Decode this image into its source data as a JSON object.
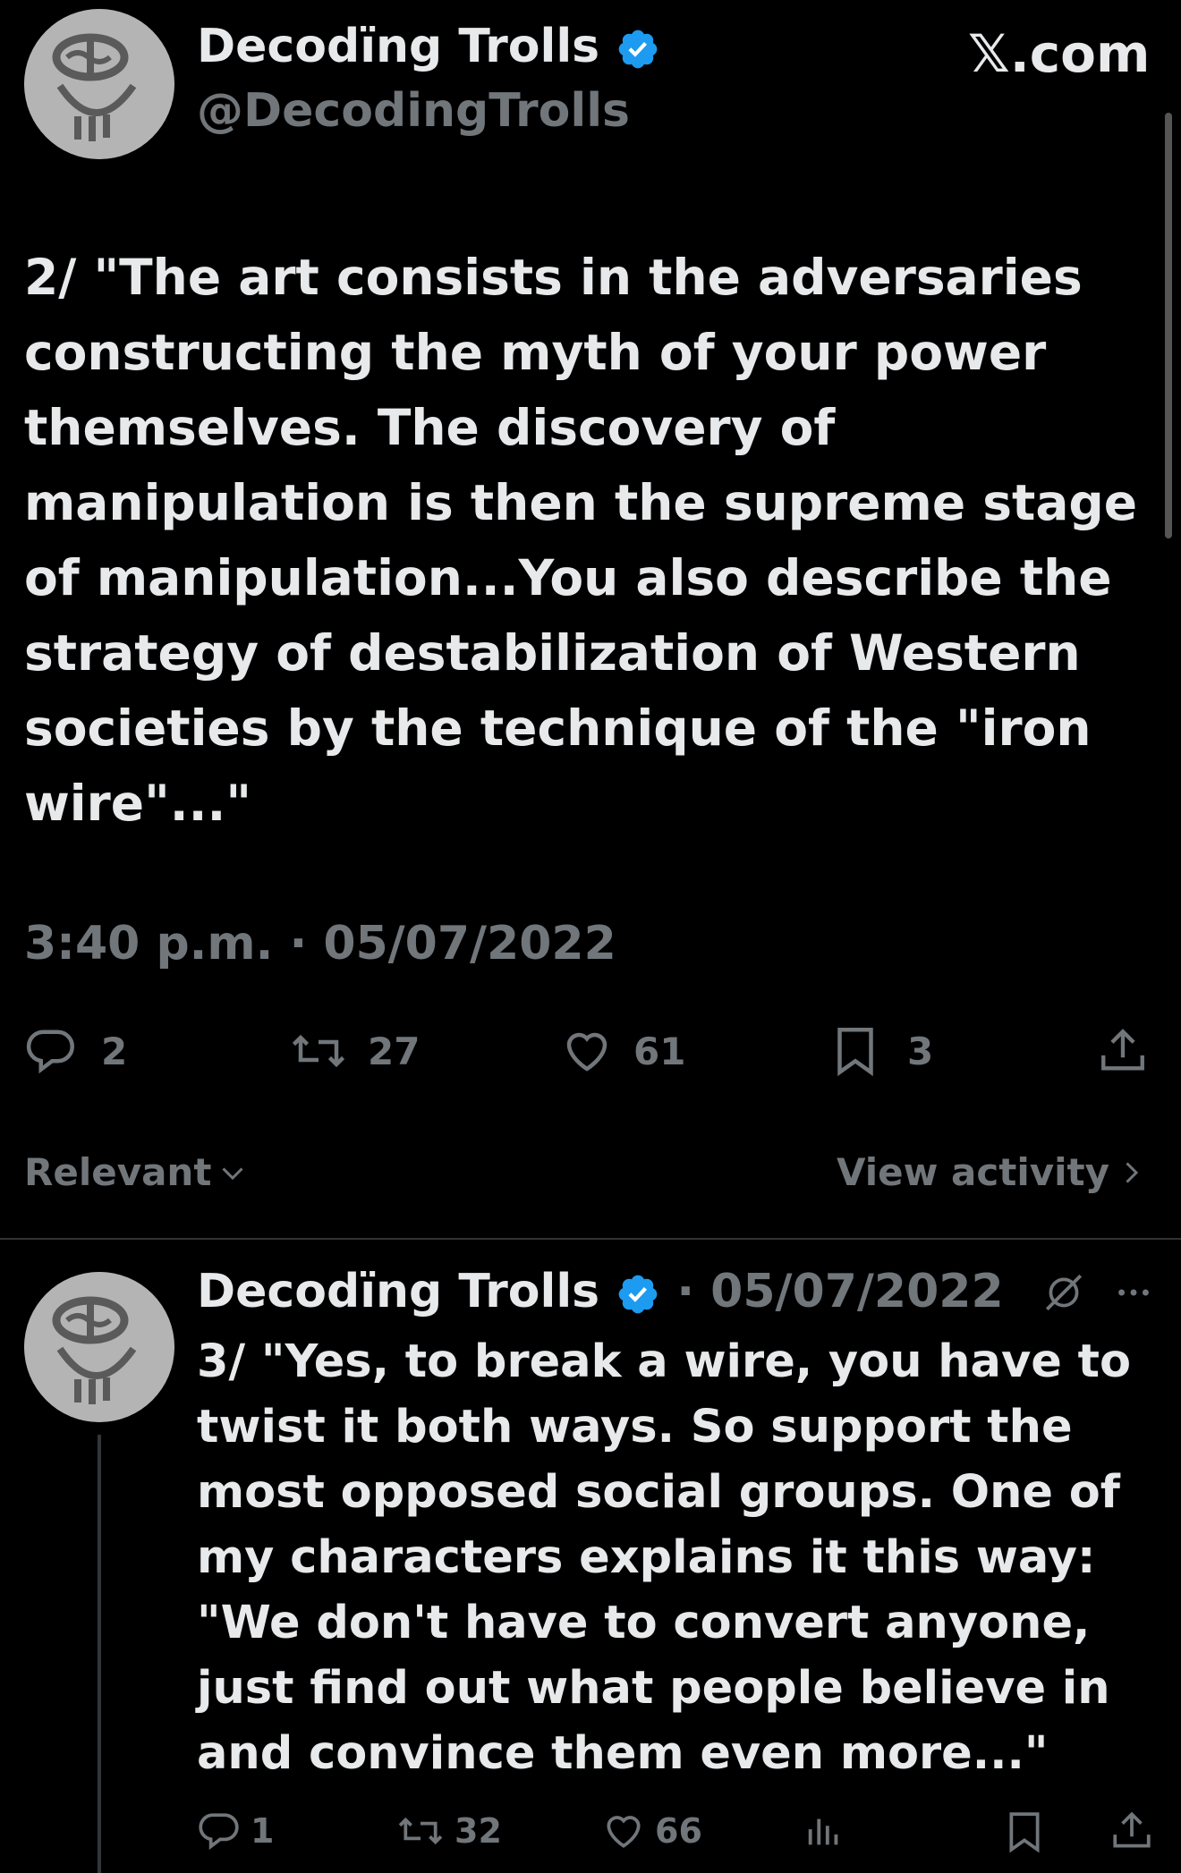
{
  "site": "𝕏.com",
  "main_tweet": {
    "author_name": "Decodïng Trolls",
    "handle": "@DecodingTrolls",
    "text": "2/ \"The art consists in the adversaries constructing the myth of your power themselves.  The discovery of manipulation is then the supreme stage of manipulation...You also describe the strategy of destabilization of Western societies by the technique of the \"iron wire\"...\"",
    "timestamp": "3:40 p.m. · 05/07/2022",
    "replies": "2",
    "reposts": "27",
    "likes": "61",
    "bookmarks": "3"
  },
  "replies_bar": {
    "sort_label": "Relevant",
    "view_activity": "View activity"
  },
  "reply_tweet": {
    "author_name": "Decodïng Trolls",
    "date": "· 05/07/2022",
    "text": "3/ \"Yes, to break a wire, you have to twist it both ways.  So support the most opposed social groups.  One of my characters explains it this way: \"We don't have to convert anyone, just find out what people believe in and convince them even more...\"",
    "replies": "1",
    "reposts": "32",
    "likes": "66"
  },
  "colors": {
    "background": "#000000",
    "text": "#e7e9ea",
    "muted": "#71767b",
    "verified": "#1d9bf0"
  },
  "icons": [
    "verified-badge-icon",
    "reply-icon",
    "repost-icon",
    "like-icon",
    "bookmark-icon",
    "share-icon",
    "chevron-down-icon",
    "chevron-right-icon",
    "grok-icon",
    "more-icon",
    "views-icon"
  ]
}
